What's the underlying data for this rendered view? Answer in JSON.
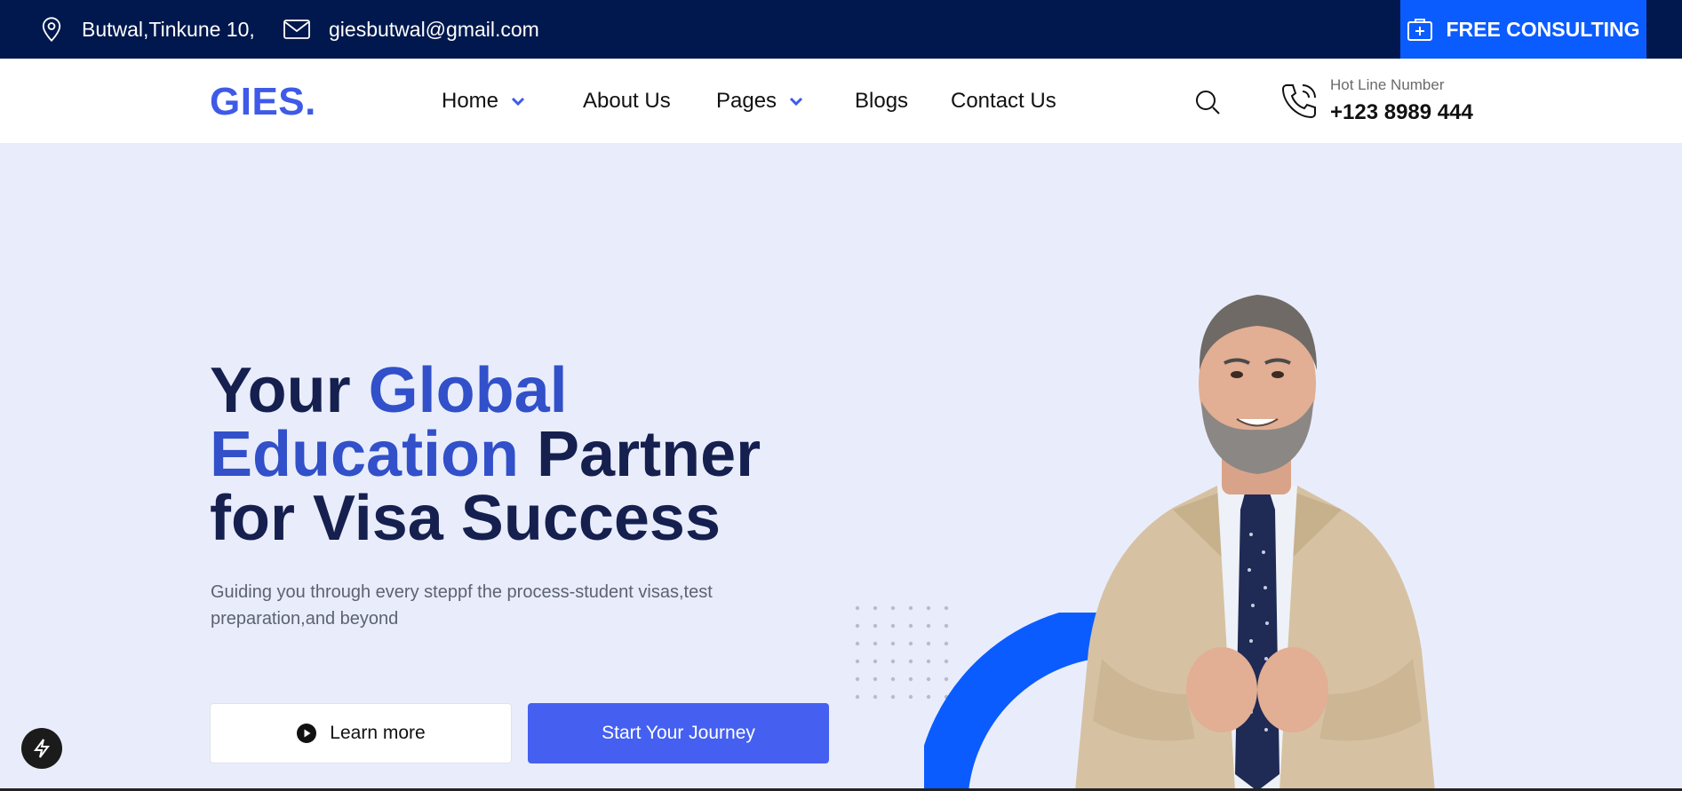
{
  "topbar": {
    "address": "Butwal,Tinkune 10,",
    "email": "giesbutwal@gmail.com",
    "consult_label": "FREE CONSULTING"
  },
  "nav": {
    "logo": "GIES.",
    "items": [
      {
        "label": "Home",
        "has_dropdown": true
      },
      {
        "label": "About Us",
        "has_dropdown": false
      },
      {
        "label": "Pages",
        "has_dropdown": true
      },
      {
        "label": "Blogs",
        "has_dropdown": false
      },
      {
        "label": "Contact Us",
        "has_dropdown": false
      }
    ],
    "hotline_label": "Hot Line Number",
    "hotline_number": "+123 8989 444"
  },
  "hero": {
    "title_part1": "Your ",
    "title_highlight1": "Global",
    "title_highlight2": "Education",
    "title_part2": " Partner",
    "title_part3": "for Visa Success",
    "subtitle": "Guiding you through every steppf the process-student visas,test preparation,and beyond",
    "learn_more": "Learn more",
    "start_journey": "Start Your Journey"
  },
  "colors": {
    "topbar_bg": "#00184d",
    "accent": "#0b5cff",
    "brand": "#3f5ae8",
    "title": "#15204f",
    "highlight": "#3150c9",
    "hero_bg": "#e9edfb"
  },
  "icons": [
    "location-pin-icon",
    "mail-icon",
    "medical-case-icon",
    "chevron-down-icon",
    "search-icon",
    "phone-icon",
    "play-circle-icon",
    "bolt-icon"
  ]
}
